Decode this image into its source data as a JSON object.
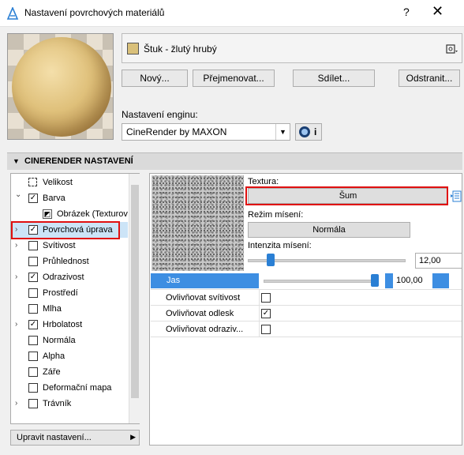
{
  "window": {
    "title": "Nastavení povrchových materiálů",
    "help": "?",
    "close": "✕"
  },
  "material": {
    "name": "Štuk - žlutý hrubý",
    "swatch_color": "#d9c07a"
  },
  "buttons": {
    "new": "Nový...",
    "rename": "Přejmenovat...",
    "share": "Sdílet...",
    "delete": "Odstranit..."
  },
  "engine": {
    "label": "Nastavení enginu:",
    "value": "CineRender by MAXON",
    "info": "i"
  },
  "section": {
    "title": "CINERENDER NASTAVENÍ"
  },
  "tree": {
    "items": [
      {
        "label": "Velikost",
        "check": "none",
        "expander": ""
      },
      {
        "label": "Barva",
        "check": "checked",
        "expander": "v"
      },
      {
        "label": "Obrázek (Texturova",
        "check": "image",
        "expander": ""
      },
      {
        "label": "Povrchová úprava",
        "check": "checked",
        "expander": ">"
      },
      {
        "label": "Svítivost",
        "check": "unchecked",
        "expander": ">"
      },
      {
        "label": "Průhlednost",
        "check": "unchecked",
        "expander": ""
      },
      {
        "label": "Odrazivost",
        "check": "checked",
        "expander": ">"
      },
      {
        "label": "Prostředí",
        "check": "unchecked",
        "expander": ""
      },
      {
        "label": "Mlha",
        "check": "unchecked",
        "expander": ""
      },
      {
        "label": "Hrbolatost",
        "check": "checked",
        "expander": ">"
      },
      {
        "label": "Normála",
        "check": "unchecked",
        "expander": ""
      },
      {
        "label": "Alpha",
        "check": "unchecked",
        "expander": ""
      },
      {
        "label": "Záře",
        "check": "unchecked",
        "expander": ""
      },
      {
        "label": "Deformační mapa",
        "check": "unchecked",
        "expander": ""
      },
      {
        "label": "Trávník",
        "check": "unchecked",
        "expander": ">"
      }
    ]
  },
  "edit_settings": "Upravit nastavení...",
  "texture": {
    "label": "Textura:",
    "value": "Šum",
    "blend_label": "Režim mísení:",
    "blend_value": "Normála",
    "intensity_label": "Intenzita mísení:",
    "intensity_value": "12,00",
    "intensity_fraction": 0.12
  },
  "jas": {
    "label": "Jas",
    "value": "100,00",
    "fraction": 1.0
  },
  "properties": [
    {
      "label": "Ovlivňovat svítivost",
      "checked": false
    },
    {
      "label": "Ovlivňovat odlesk",
      "checked": true
    },
    {
      "label": "Ovlivňovat odraziv...",
      "checked": false
    }
  ],
  "colors": {
    "accent": "#3d8ee2",
    "highlight_box": "#e01010",
    "selection": "#cce4f7"
  }
}
